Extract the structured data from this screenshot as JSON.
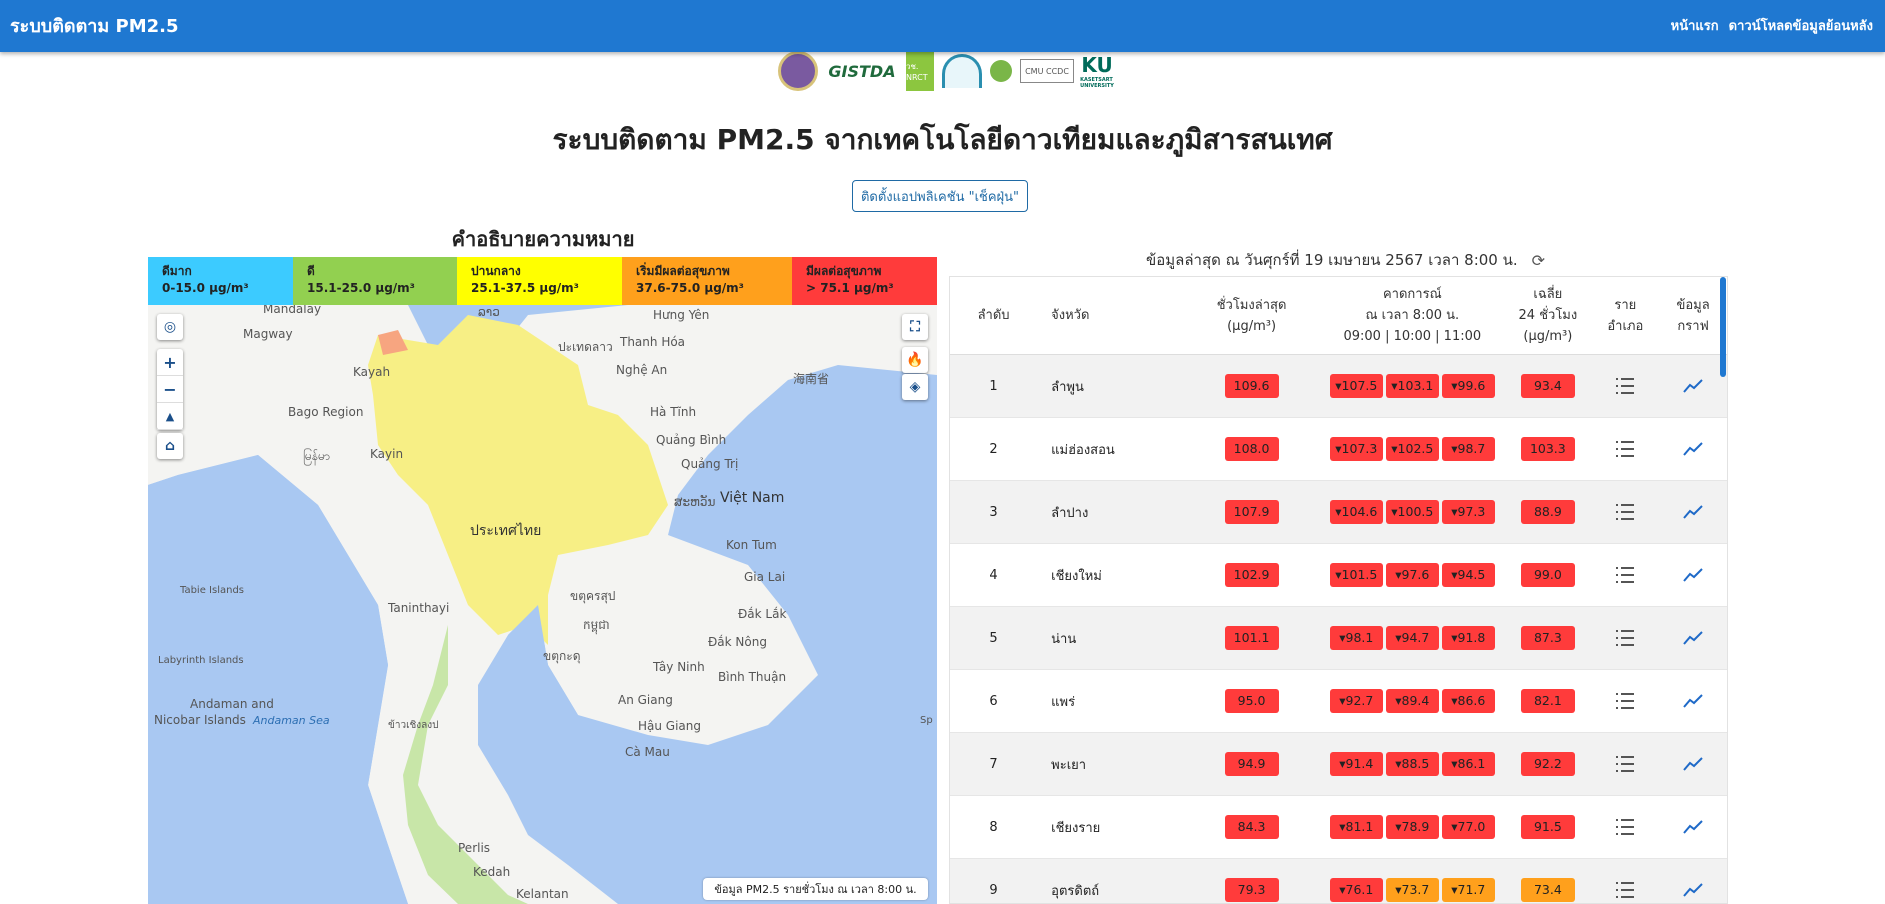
{
  "nav": {
    "brand": "ระบบติดตาม PM2.5",
    "links": [
      "หน้าแรก",
      "ดาวน์โหลดข้อมูลย้อนหลัง"
    ]
  },
  "logos": {
    "gistda": "GISTDA",
    "nrct": "วช. NRCT",
    "cmu": "CMU CCDC",
    "ku": "KU",
    "ku_sub": "KASETSART UNIVERSITY"
  },
  "page_title": "ระบบติดตาม PM2.5 จากเทคโนโลยีดาวเทียมและภูมิสารสนเทศ",
  "install_button": "ติดตั้งแอปพลิเคชัน \"เช็คฝุ่น\"",
  "legend_title": "คำอธิบายความหมาย",
  "legend": [
    {
      "name": "ดีมาก",
      "range": "0-15.0 µg/m³",
      "color": "#3ccbff"
    },
    {
      "name": "ดี",
      "range": "15.1-25.0 µg/m³",
      "color": "#92d050"
    },
    {
      "name": "ปานกลาง",
      "range": "25.1-37.5 µg/m³",
      "color": "#ffff00"
    },
    {
      "name": "เริ่มมีผลต่อสุขภาพ",
      "range": "37.6-75.0 µg/m³",
      "color": "#ffa01c"
    },
    {
      "name": "มีผลต่อสุขภาพ",
      "range": "> 75.1 µg/m³",
      "color": "#ff3b3b"
    }
  ],
  "map": {
    "labels": [
      "Mandalay",
      "Magway",
      "Kayah",
      "Bago Region",
      "Kayin",
      "Taninthayi",
      "Tabie Islands",
      "Labyrinth Islands",
      "Andaman and",
      "Nicobar Islands",
      "Andaman Sea",
      "Perlis",
      "Kedah",
      "Kelantan",
      "Hưng Yên",
      "Thanh Hóa",
      "Nghệ An",
      "Hà Tĩnh",
      "Quảng Bình",
      "Quảng Trị",
      "Việt Nam",
      "Kon Tum",
      "Gia Lai",
      "Đắk Lắk",
      "Đắk Nông",
      "Bình Thuận",
      "Tây Ninh",
      "An Giang",
      "Hậu Giang",
      "Cà Mau",
      "海南省",
      "ประเทศไทย",
      "မြန်မာ",
      "ລາວ",
      "ສະຫວັນ",
      "ขตุครสุป",
      "កម្ពុជា",
      "ขตุกะดุ",
      "ข้าวเชิงลงป",
      "Sp",
      "ปะเทดลาว"
    ],
    "caption": "ข้อมูล PM2.5 รายชั่วโมง ณ เวลา 8:00 น.",
    "controls": {
      "plus": "+",
      "minus": "−"
    }
  },
  "update_text": "ข้อมูลล่าสุด ณ วันศุกร์ที่ 19 เมษายน 2567 เวลา 8:00 น.",
  "table": {
    "headers": {
      "no": "ลำดับ",
      "province": "จังหวัด",
      "hour": [
        "ชั่วโมงล่าสุด",
        "(µg/m³)"
      ],
      "forecast": [
        "คาดการณ์",
        "ณ เวลา 8:00 น.",
        "09:00 | 10:00 | 11:00"
      ],
      "avg": [
        "เฉลี่ย",
        "24 ชั่วโมง",
        "(µg/m³)"
      ],
      "district": [
        "ราย",
        "อำเภอ"
      ],
      "graph": [
        "ข้อมูล",
        "กราฟ"
      ]
    },
    "rows": [
      {
        "no": "1",
        "province": "ลำพูน",
        "hour": "109.6",
        "fc": [
          "▾107.5",
          "▾103.1",
          "▾99.6"
        ],
        "avg": "93.4"
      },
      {
        "no": "2",
        "province": "แม่ฮ่องสอน",
        "hour": "108.0",
        "fc": [
          "▾107.3",
          "▾102.5",
          "▾98.7"
        ],
        "avg": "103.3"
      },
      {
        "no": "3",
        "province": "ลำปาง",
        "hour": "107.9",
        "fc": [
          "▾104.6",
          "▾100.5",
          "▾97.3"
        ],
        "avg": "88.9"
      },
      {
        "no": "4",
        "province": "เชียงใหม่",
        "hour": "102.9",
        "fc": [
          "▾101.5",
          "▾97.6",
          "▾94.5"
        ],
        "avg": "99.0"
      },
      {
        "no": "5",
        "province": "น่าน",
        "hour": "101.1",
        "fc": [
          "▾98.1",
          "▾94.7",
          "▾91.8"
        ],
        "avg": "87.3"
      },
      {
        "no": "6",
        "province": "แพร่",
        "hour": "95.0",
        "fc": [
          "▾92.7",
          "▾89.4",
          "▾86.6"
        ],
        "avg": "82.1"
      },
      {
        "no": "7",
        "province": "พะเยา",
        "hour": "94.9",
        "fc": [
          "▾91.4",
          "▾88.5",
          "▾86.1"
        ],
        "avg": "92.2"
      },
      {
        "no": "8",
        "province": "เชียงราย",
        "hour": "84.3",
        "fc": [
          "▾81.1",
          "▾78.9",
          "▾77.0"
        ],
        "avg": "91.5"
      },
      {
        "no": "9",
        "province": "อุตรดิตถ์",
        "hour": "79.3",
        "fc": [
          "▾76.1",
          "▾73.7",
          "▾71.7"
        ],
        "avg": "73.4"
      }
    ]
  },
  "colors": {
    "navbar": "#1f78d1",
    "unhealthy": "#ff3b3b",
    "sensitive": "#ffa01c"
  }
}
